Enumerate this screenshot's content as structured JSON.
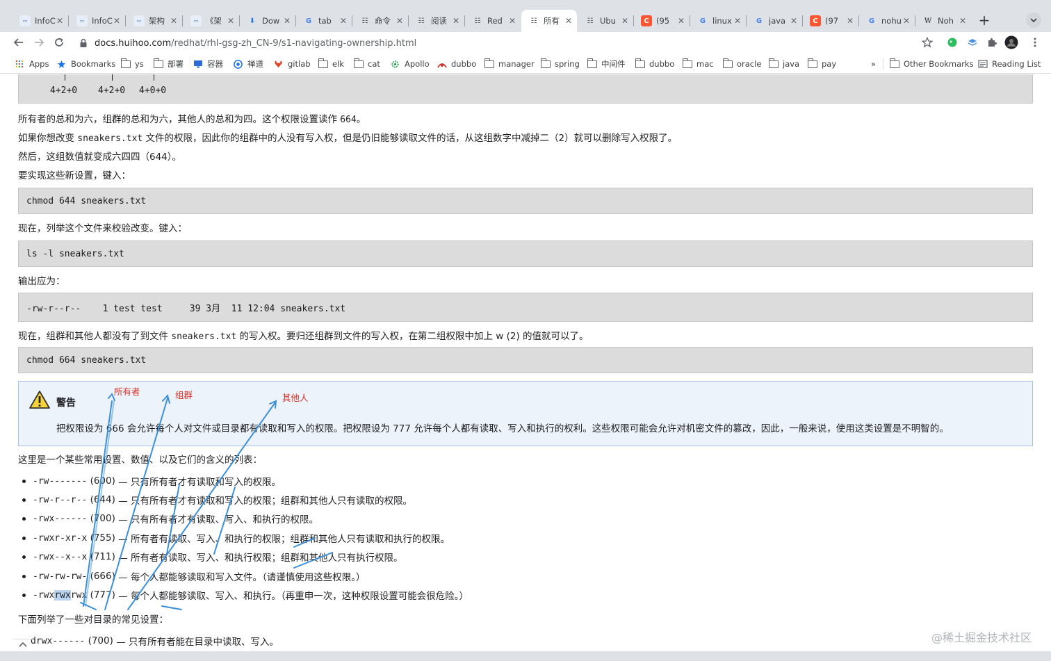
{
  "browser": {
    "tabs": [
      {
        "title": "InfoC",
        "icon": "site-favicon-icon"
      },
      {
        "title": "InfoC",
        "icon": "site-favicon-icon"
      },
      {
        "title": "架构",
        "icon": "site-favicon-icon"
      },
      {
        "title": "《架",
        "icon": "site-favicon-icon"
      },
      {
        "title": "Dow",
        "icon": "download-icon"
      },
      {
        "title": "tab",
        "icon": "google-icon"
      },
      {
        "title": "命令",
        "icon": "book-icon"
      },
      {
        "title": "阅读",
        "icon": "book-icon"
      },
      {
        "title": "Red",
        "icon": "book-icon"
      },
      {
        "title": "所有",
        "icon": "book-icon"
      },
      {
        "title": "Ubu",
        "icon": "book-icon"
      },
      {
        "title": "(95",
        "icon": "csdn-icon"
      },
      {
        "title": "linux",
        "icon": "google-icon"
      },
      {
        "title": "java",
        "icon": "google-icon"
      },
      {
        "title": "(97",
        "icon": "csdn-icon"
      },
      {
        "title": "nohu",
        "icon": "google-icon"
      },
      {
        "title": "Noh",
        "icon": "wikipedia-icon"
      }
    ],
    "active_tab_index": 9,
    "new_tab_label": "+",
    "url_host": "docs.huihoo.com",
    "url_path": "/redhat/rhl-gsg-zh_CN-9/s1-navigating-ownership.html",
    "bookmarks": [
      {
        "label": "Apps",
        "icon": "apps-grid-icon"
      },
      {
        "label": "Bookmarks",
        "icon": "star-icon"
      },
      {
        "label": "ys",
        "icon": "folder-icon"
      },
      {
        "label": "部署",
        "icon": "folder-icon"
      },
      {
        "label": "容器",
        "icon": "monitor-icon"
      },
      {
        "label": "禅道",
        "icon": "zentao-icon"
      },
      {
        "label": "gitlab",
        "icon": "gitlab-icon"
      },
      {
        "label": "elk",
        "icon": "folder-icon"
      },
      {
        "label": "cat",
        "icon": "folder-icon"
      },
      {
        "label": "Apollo",
        "icon": "gear-icon"
      },
      {
        "label": "dubbo",
        "icon": "dubbo-icon"
      },
      {
        "label": "manager",
        "icon": "folder-icon"
      },
      {
        "label": "spring",
        "icon": "folder-icon"
      },
      {
        "label": "中间件",
        "icon": "folder-icon"
      },
      {
        "label": "dubbo",
        "icon": "folder-icon"
      },
      {
        "label": "mac",
        "icon": "folder-icon"
      },
      {
        "label": "oracle",
        "icon": "folder-icon"
      },
      {
        "label": "java",
        "icon": "folder-icon"
      },
      {
        "label": "pay",
        "icon": "folder-icon"
      }
    ],
    "overflow_label": "»",
    "other_bookmarks": "Other Bookmarks",
    "reading_list": "Reading List"
  },
  "page": {
    "top_code_values": [
      "4+2+0",
      "4+2+0",
      "4+0+0"
    ],
    "p1_text": "所有者的总和为六，组群的总和为六，其他人的总和为四。这个权限设置读作 ",
    "p1_code": "664",
    "p1_end": "。",
    "p2_text": "如果你想改变 ",
    "p2_code": "sneakers.txt",
    "p2_end": " 文件的权限，因此你的组群中的人没有写入权，但是仍旧能够读取文件的话，从这组数字中减掉二（2）就可以删除写入权限了。",
    "p3": "然后，这组数值就变成六四四（644）。",
    "p4": "要实现这些新设置，键入：",
    "code1": "chmod 644 sneakers.txt",
    "p5": "现在，列举这个文件来校验改变。键入：",
    "code2": "ls -l sneakers.txt",
    "p6": "输出应为：",
    "code3": "-rw-r--r--    1 test test     39 3月  11 12:04 sneakers.txt",
    "p7_text": "现在，组群和其他人都没有了到文件 ",
    "p7_code": "sneakers.txt",
    "p7_end": " 的写入权。要归还组群到文件的写入权，在第二组权限中加上 w (2) 的值就可以了。",
    "code4": "chmod 664 sneakers.txt",
    "warning_title": "警告",
    "warning_body": "把权限设为 666 会允许每个人对文件或目录都有读取和写入的权限。把权限设为 777 允许每个人都有读取、写入和执行的权利。这些权限可能会允许对机密文件的篡改，因此，一般来说，使用这类设置是不明智的。",
    "list_intro": "这里是一个某些常用设置、数值、以及它们的含义的列表：",
    "list_items": [
      {
        "perm": "-rw-------",
        "value": "(600)",
        "desc": "— 只有所有者才有读取和写入的权限。"
      },
      {
        "perm": "-rw-r--r--",
        "value": "(644)",
        "desc": "— 只有所有者才有读取和写入的权限；组群和其他人只有读取的权限。"
      },
      {
        "perm": "-rwx------",
        "value": "(700)",
        "desc": "— 只有所有者才有读取、写入、和执行的权限。"
      },
      {
        "perm": "-rwxr-xr-x",
        "value": "(755)",
        "desc": "— 所有者有读取、写入、和执行的权限；组群和其他人只有读取和执行的权限。"
      },
      {
        "perm": "-rwx--x--x",
        "value": "(711)",
        "desc": "— 所有者有读取、写入、和执行权限；组群和其他人只有执行权限。"
      },
      {
        "perm": "-rw-rw-rw-",
        "value": "(666)",
        "desc": "— 每个人都能够读取和写入文件。（请谨慎使用这些权限。）"
      },
      {
        "perm_a": "-rwx",
        "perm_b": "rwx",
        "perm_c": "rwx",
        "value": "(777)",
        "desc": "— 每个人都能够读取、写入、和执行。（再重申一次，这种权限设置可能会很危险。）"
      }
    ],
    "dir_intro": "下面列举了一些对目录的常见设置：",
    "dir_item": {
      "perm": "drwx------",
      "value": "(700)",
      "desc": "— 只有所有者能在目录中读取、写入。"
    },
    "annotations": {
      "owner": "所有者",
      "group": "组群",
      "others": "其他人"
    },
    "annotation_color": "#d93025",
    "arrow_color": "#3b8fd9",
    "watermark": "@稀土掘金技术社区"
  }
}
